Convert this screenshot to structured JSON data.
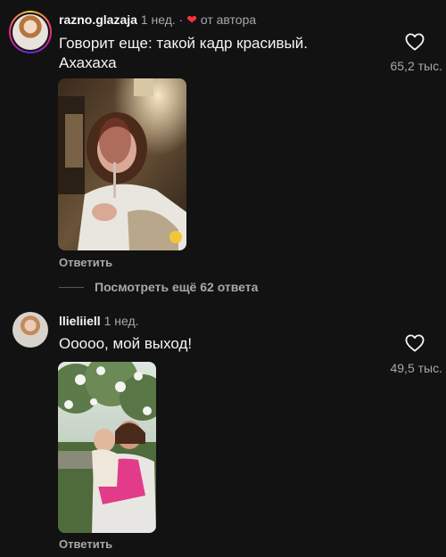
{
  "comments": [
    {
      "username": "razno.glazaja",
      "time": "1 нед.",
      "separator": "·",
      "author_badge": "от автора",
      "text": "Говорит еще: такой кадр красивый. Ахахаха",
      "likes": "65,2 тыс.",
      "reply_label": "Ответить"
    },
    {
      "username": "llieliiell",
      "time": "1 нед.",
      "text": "Ооооо, мой выход!",
      "likes": "49,5 тыс.",
      "reply_label": "Ответить"
    }
  ],
  "view_more_replies": "Посмотреть ещё 62 ответа",
  "icons": {
    "like": "heart-outline-icon",
    "author_like": "heart-filled-icon"
  },
  "colors": {
    "background": "#121212",
    "text_primary": "#f5f5f5",
    "text_secondary": "#a8a8a8",
    "heart_red": "#ff3040"
  }
}
